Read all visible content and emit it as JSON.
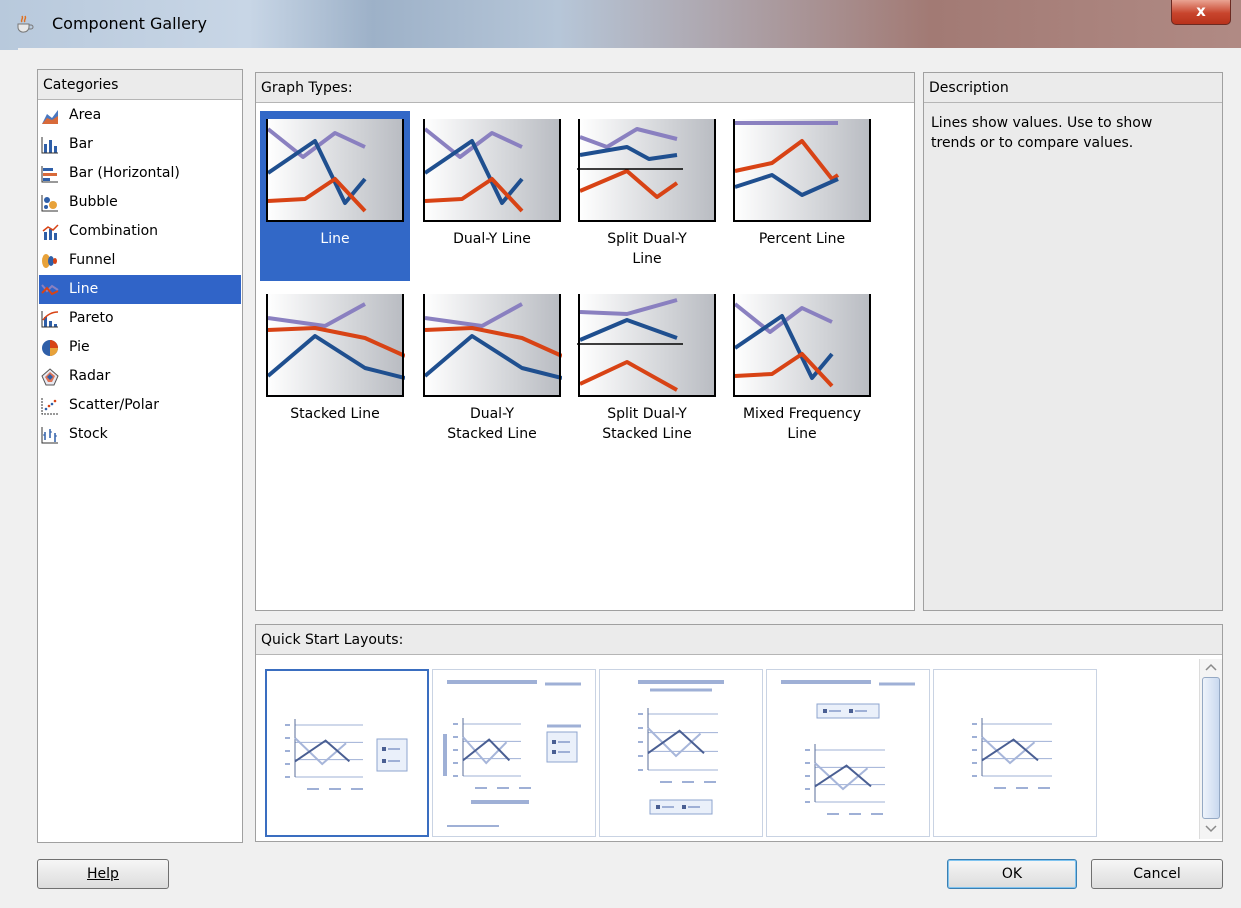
{
  "window": {
    "title": "Component Gallery",
    "close_label": "x"
  },
  "categories": {
    "header": "Categories",
    "selected": "Line",
    "items": [
      {
        "label": "Area",
        "icon": "area-chart-icon"
      },
      {
        "label": "Bar",
        "icon": "bar-chart-icon"
      },
      {
        "label": "Bar (Horizontal)",
        "icon": "horizontal-bar-chart-icon"
      },
      {
        "label": "Bubble",
        "icon": "bubble-chart-icon"
      },
      {
        "label": "Combination",
        "icon": "combination-chart-icon"
      },
      {
        "label": "Funnel",
        "icon": "funnel-chart-icon"
      },
      {
        "label": "Line",
        "icon": "line-chart-icon"
      },
      {
        "label": "Pareto",
        "icon": "pareto-chart-icon"
      },
      {
        "label": "Pie",
        "icon": "pie-chart-icon"
      },
      {
        "label": "Radar",
        "icon": "radar-chart-icon"
      },
      {
        "label": "Scatter/Polar",
        "icon": "scatter-chart-icon"
      },
      {
        "label": "Stock",
        "icon": "stock-chart-icon"
      }
    ]
  },
  "graph_types": {
    "header": "Graph Types:",
    "selected": "Line",
    "items": [
      {
        "line1": "Line",
        "line2": ""
      },
      {
        "line1": "Dual-Y Line",
        "line2": ""
      },
      {
        "line1": "Split Dual-Y",
        "line2": "Line"
      },
      {
        "line1": "Percent Line",
        "line2": ""
      },
      {
        "line1": "Stacked Line",
        "line2": ""
      },
      {
        "line1": "Dual-Y",
        "line2": "Stacked Line"
      },
      {
        "line1": "Split Dual-Y",
        "line2": "Stacked Line"
      },
      {
        "line1": "Mixed Frequency",
        "line2": "Line"
      }
    ]
  },
  "description": {
    "header": "Description",
    "text_line1": "Lines show values. Use to show",
    "text_line2": "trends or to compare values."
  },
  "quick_start": {
    "header": "Quick Start Layouts:",
    "layout_count": 5,
    "selected_index": 0
  },
  "buttons": {
    "help": "Help",
    "ok": "OK",
    "cancel": "Cancel"
  },
  "colors": {
    "selection": "#3268c7",
    "series_purple": "#8a80c0",
    "series_blue": "#1f4f8f",
    "series_orange": "#d84315",
    "layout_line": "#9fb0d6"
  }
}
